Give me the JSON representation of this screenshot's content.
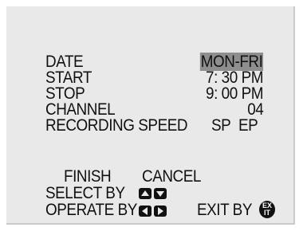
{
  "menu": {
    "date_label": "DATE",
    "date_value": "MON-FRI",
    "start_label": "START",
    "start_value": "7: 30  PM",
    "stop_label": "STOP",
    "stop_value": "9: 00  PM",
    "channel_label": "CHANNEL",
    "channel_value": "04",
    "speed_label": "RECORDING SPEED",
    "speed_sp": "SP",
    "speed_ep": "EP"
  },
  "actions": {
    "finish": "FINISH",
    "cancel": "CANCEL"
  },
  "guide": {
    "select_label": "SELECT  BY",
    "operate_label": "OPERATE BY",
    "exit_label": "EXIT BY",
    "exit_button_text": "EXIT"
  },
  "colors": {
    "screen_background": "#e9e9e9",
    "highlight": "#8e8e8e",
    "text": "#111111"
  },
  "icons": [
    "up-arrow-icon",
    "down-arrow-icon",
    "left-arrow-icon",
    "right-arrow-icon",
    "exit-button-icon"
  ]
}
